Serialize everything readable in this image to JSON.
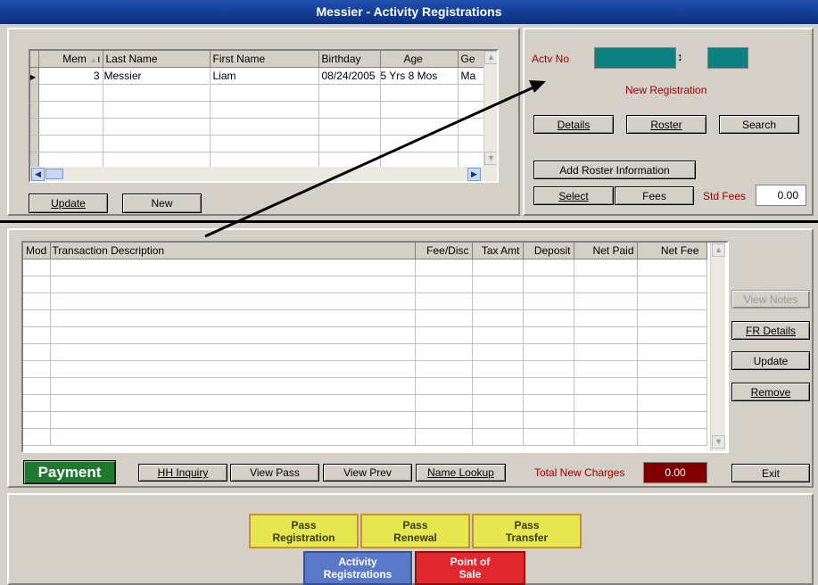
{
  "window": {
    "title": "Messier - Activity Registrations"
  },
  "members": {
    "columns": [
      "Mem",
      "Last Name",
      "First Name",
      "Birthday",
      "Age",
      "Ge"
    ],
    "rows": [
      [
        "3",
        "Messier",
        "Liam",
        "08/24/2005",
        "5 Yrs 8 Mos",
        "Ma"
      ]
    ],
    "update_label": "Update",
    "new_label": "New"
  },
  "activity": {
    "actv_no_label": "Actv No",
    "actv_no_value": "",
    "actv_sub_value": "",
    "status_text": "New Registration",
    "details_label": "Details",
    "roster_label": "Roster",
    "search_label": "Search",
    "add_roster_label": "Add Roster Information",
    "select_label": "Select",
    "fees_label": "Fees",
    "std_fees_label": "Std Fees",
    "std_fees_value": "0.00"
  },
  "transactions": {
    "columns": [
      "Mod",
      "Transaction Description",
      "Fee/Disc",
      "Tax Amt",
      "Deposit",
      "Net Paid",
      "Net Fee"
    ],
    "view_notes_label": "View Notes",
    "fr_details_label": "FR Details",
    "update_label": "Update",
    "remove_label": "Remove"
  },
  "footer": {
    "payment_label": "Payment",
    "hh_inquiry_label": "HH Inquiry",
    "view_pass_label": "View Pass",
    "view_prev_label": "View Prev",
    "name_lookup_label": "Name Lookup",
    "total_new_charges_label": "Total New Charges",
    "total_new_charges_value": "0.00",
    "exit_label": "Exit"
  },
  "launcher": {
    "pass_registration": [
      "Pass",
      "Registration"
    ],
    "pass_renewal": [
      "Pass",
      "Renewal"
    ],
    "pass_transfer": [
      "Pass",
      "Transfer"
    ],
    "activity_registrations": [
      "Activity",
      "Registrations"
    ],
    "point_of_sale": [
      "Point of",
      "Sale"
    ]
  },
  "colors": {
    "title_bg": "#0a2e7e",
    "teal_field": "#0f8080",
    "payment_bg": "#1d7a2c",
    "total_bg": "#800000",
    "pass_bg": "#e6e650",
    "activity_bg": "#5a78c8",
    "pos_bg": "#e0282e"
  }
}
